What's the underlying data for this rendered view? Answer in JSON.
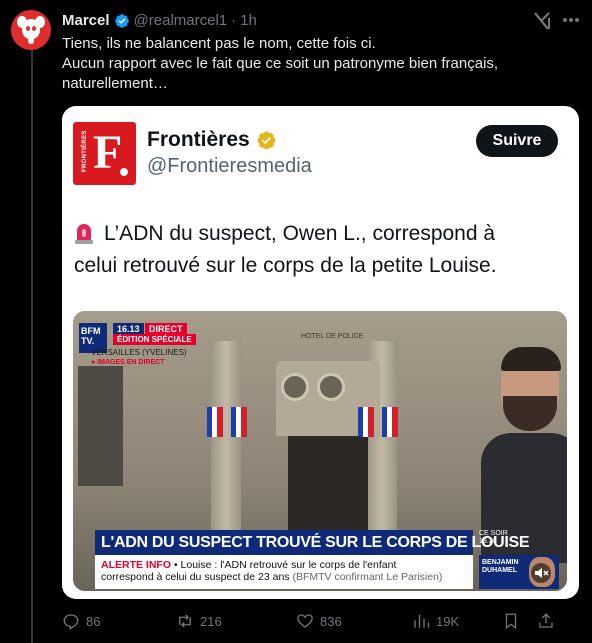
{
  "author": {
    "name": "Marcel",
    "handle": "@realmarcel1",
    "time": "1h"
  },
  "tweet": {
    "lines": [
      "Tiens, ils ne balancent pas le nom, cette fois ci.",
      "Aucun rapport avec le fait que ce soit un patronyme bien français,",
      "naturellement…"
    ]
  },
  "quote": {
    "name": "Frontières",
    "handle": "@Frontieresmedia",
    "follow_label": "Suivre",
    "logo_vertical_text": "FRONTIÈRES",
    "logo_letter": "F",
    "text_lines": [
      "L’ADN du suspect, Owen L., correspond à",
      "celui retrouvé sur le corps de la petite Louise."
    ],
    "media": {
      "channel": "BFM TV.",
      "time": "16.13",
      "direct": "DIRECT",
      "edition": "ÉDITION SPÉCIALE",
      "place": "VERSAILLES (YVELINES)",
      "live": "● IMAGES EN DIRECT",
      "building_sign": "HOTEL DE POLICE",
      "banner": "L'ADN DU SUSPECT TROUVÉ SUR LE CORPS DE LOUISE",
      "alert_label": "ALERTE INFO",
      "alert_line1": " • Louise : l'ADN retrouvé sur le corps de l'enfant",
      "alert_line2": "correspond à celui du suspect de 23 ans",
      "alert_source": "  (BFMTV confirmant Le Parisien)",
      "ce_soir": "CE SOIR\n19.20",
      "guest": "BENJAMIN\nDUHAMEL"
    }
  },
  "actions": {
    "replies": "86",
    "reposts": "216",
    "likes": "836",
    "views": "19K"
  },
  "colors": {
    "background": "#000000",
    "text": "#e7e9ea",
    "muted": "#71767b",
    "verified_blue": "#1d9bf0",
    "verified_gold": "#e2b719",
    "frontieres_red": "#d8191f",
    "bfm_blue": "#0e2a78"
  }
}
